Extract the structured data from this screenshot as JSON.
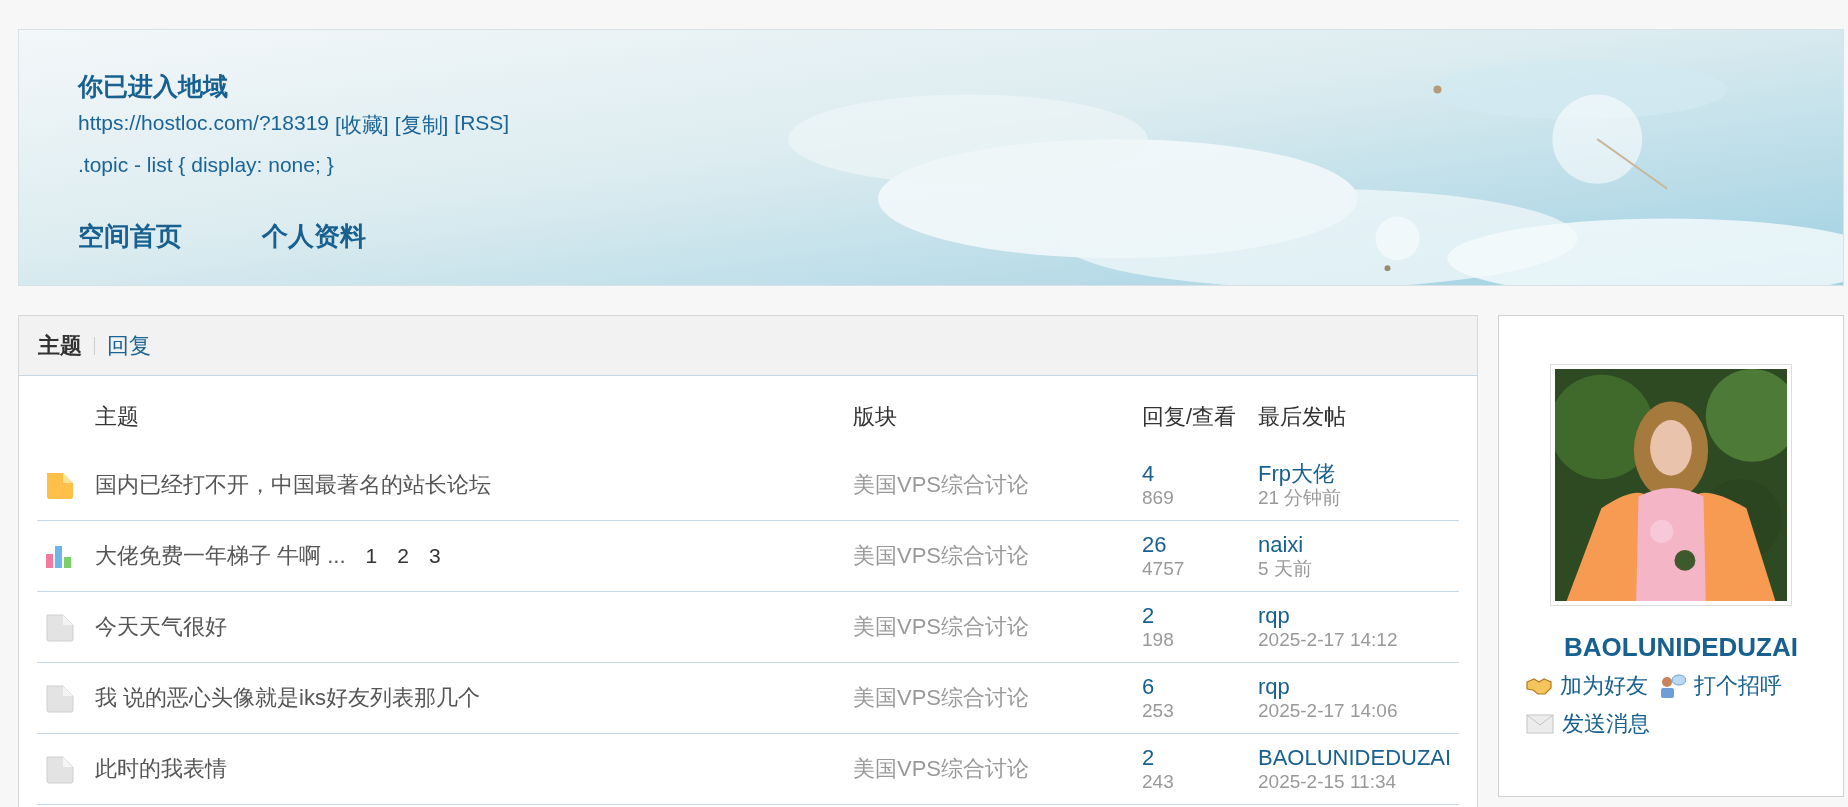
{
  "header": {
    "title": "你已进入地域",
    "url": "https://hostloc.com/?18319",
    "url_actions": [
      "[收藏]",
      "[复制]",
      "[RSS]"
    ],
    "motto": ".topic - list { display: none; }",
    "nav": [
      "空间首页",
      "个人资料"
    ]
  },
  "tabs": [
    {
      "label": "主题",
      "selected": true
    },
    {
      "label": "回复",
      "selected": false
    }
  ],
  "table": {
    "columns": [
      "主题",
      "版块",
      "回复/查看",
      "最后发帖"
    ],
    "rows": [
      {
        "kind": "hot",
        "title": "国内已经打不开，中国最著名的站长论坛",
        "pages": [],
        "forum": "美国VPS综合讨论",
        "replies": "4",
        "views": "869",
        "last_user": "Frp大佬",
        "last_time": "21 分钟前"
      },
      {
        "kind": "poll",
        "title": "大佬免费一年梯子 牛啊 ...",
        "pages": [
          "1",
          "2",
          "3"
        ],
        "forum": "美国VPS综合讨论",
        "replies": "26",
        "views": "4757",
        "last_user": "naixi",
        "last_time": "5 天前"
      },
      {
        "kind": "normal",
        "title": "今天天气很好",
        "pages": [],
        "forum": "美国VPS综合讨论",
        "replies": "2",
        "views": "198",
        "last_user": "rqp",
        "last_time": "2025-2-17 14:12"
      },
      {
        "kind": "normal",
        "title": "我 说的恶心头像就是iks好友列表那几个",
        "pages": [],
        "forum": "美国VPS综合讨论",
        "replies": "6",
        "views": "253",
        "last_user": "rqp",
        "last_time": "2025-2-17 14:06"
      },
      {
        "kind": "normal",
        "title": "此时的我表情",
        "pages": [],
        "forum": "美国VPS综合讨论",
        "replies": "2",
        "views": "243",
        "last_user": "BAOLUNIDEDUZAI",
        "last_time": "2025-2-15 11:34"
      }
    ]
  },
  "profile": {
    "username": "BAOLUNIDEDUZAI",
    "actions": [
      {
        "kind": "friend",
        "label": "加为好友"
      },
      {
        "kind": "poke",
        "label": "打个招呼"
      },
      {
        "kind": "message",
        "label": "发送消息"
      }
    ]
  }
}
